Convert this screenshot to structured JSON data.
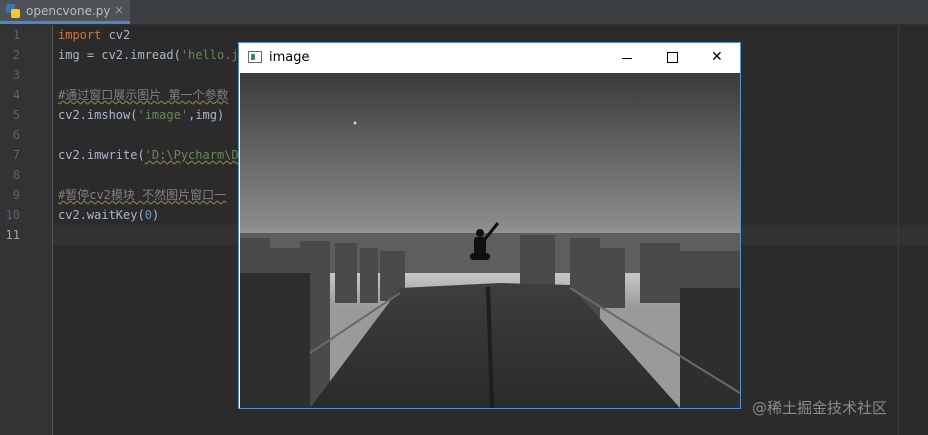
{
  "tab": {
    "filename": "opencvone.py",
    "close": "×",
    "icon": "python-file-icon"
  },
  "gutter": {
    "lines": [
      "1",
      "2",
      "3",
      "4",
      "5",
      "6",
      "7",
      "8",
      "9",
      "10",
      "11"
    ],
    "current": "11"
  },
  "code": {
    "l1_kw": "import",
    "l1_rest": " cv2",
    "l2_a": "img = cv2.imread(",
    "l2_str": "'hello.jp",
    "l4_cmt": "#通过窗口展示图片 第一个参数",
    "l5_a": "cv2.imshow(",
    "l5_str": "'image'",
    "l5_b": ",img)",
    "l7_a": "cv2.imwrite(",
    "l7_str": "'D:\\Pycharm\\De",
    "l9_cmt": "#暂停cv2模块 不然图片窗口一",
    "l10_a": "cv2.waitKey(",
    "l10_num": "0",
    "l10_b": ")"
  },
  "window": {
    "title": "image",
    "icon": "opencv-window-icon",
    "close_glyph": "✕"
  },
  "watermark": "@稀土掘金技术社区",
  "colors": {
    "editor_bg": "#2b2b2b",
    "keyword": "#cc7832",
    "string": "#6a8759",
    "comment": "#808080",
    "number": "#6897bb",
    "window_border": "#5a8fcf"
  }
}
